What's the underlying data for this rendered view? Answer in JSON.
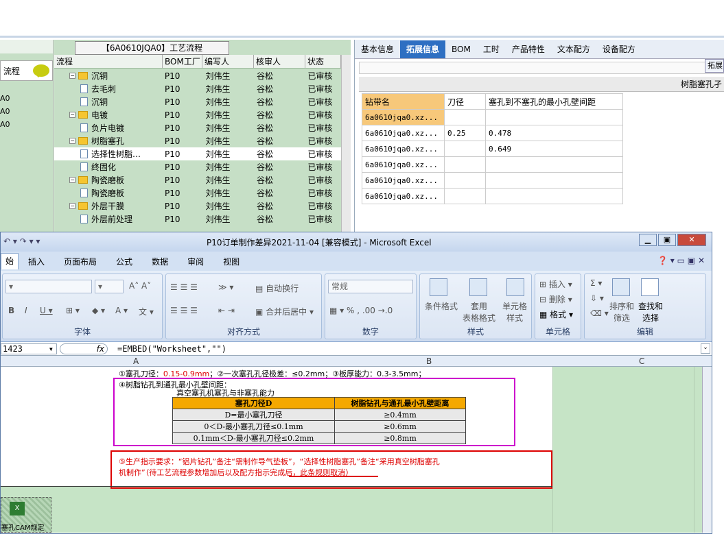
{
  "left_panel": {
    "button_label": "流程",
    "rows": [
      "A0",
      "A0",
      "A0"
    ]
  },
  "tree": {
    "window_title": "【6A0610JQA0】工艺流程",
    "columns": [
      "流程",
      "BOM工厂",
      "编写人",
      "核审人",
      "状态"
    ],
    "rows": [
      {
        "level": 1,
        "type": "folder",
        "name": "沉铜",
        "bom": "P10",
        "author": "刘伟生",
        "reviewer": "谷松",
        "status": "已审核"
      },
      {
        "level": 2,
        "type": "doc",
        "name": "去毛刺",
        "bom": "P10",
        "author": "刘伟生",
        "reviewer": "谷松",
        "status": "已审核"
      },
      {
        "level": 2,
        "type": "doc",
        "name": "沉铜",
        "bom": "P10",
        "author": "刘伟生",
        "reviewer": "谷松",
        "status": "已审核"
      },
      {
        "level": 1,
        "type": "folder",
        "name": "电镀",
        "bom": "P10",
        "author": "刘伟生",
        "reviewer": "谷松",
        "status": "已审核"
      },
      {
        "level": 2,
        "type": "doc",
        "name": "负片电镀",
        "bom": "P10",
        "author": "刘伟生",
        "reviewer": "谷松",
        "status": "已审核"
      },
      {
        "level": 1,
        "type": "folder",
        "name": "树脂塞孔",
        "bom": "P10",
        "author": "刘伟生",
        "reviewer": "谷松",
        "status": "已审核"
      },
      {
        "level": 2,
        "type": "doc",
        "name": "选择性树脂…",
        "bom": "P10",
        "author": "刘伟生",
        "reviewer": "谷松",
        "status": "已审核",
        "selected": true
      },
      {
        "level": 2,
        "type": "doc",
        "name": "终固化",
        "bom": "P10",
        "author": "刘伟生",
        "reviewer": "谷松",
        "status": "已审核"
      },
      {
        "level": 1,
        "type": "folder",
        "name": "陶瓷磨板",
        "bom": "P10",
        "author": "刘伟生",
        "reviewer": "谷松",
        "status": "已审核"
      },
      {
        "level": 2,
        "type": "doc",
        "name": "陶瓷磨板",
        "bom": "P10",
        "author": "刘伟生",
        "reviewer": "谷松",
        "status": "已审核"
      },
      {
        "level": 1,
        "type": "folder",
        "name": "外层干膜",
        "bom": "P10",
        "author": "刘伟生",
        "reviewer": "谷松",
        "status": "已审核"
      },
      {
        "level": 2,
        "type": "doc",
        "name": "外层前处理",
        "bom": "P10",
        "author": "刘伟生",
        "reviewer": "谷松",
        "status": "已审核"
      }
    ]
  },
  "right_panel": {
    "tabs": [
      "基本信息",
      "拓展信息",
      "BOM",
      "工时",
      "产品特性",
      "文本配方",
      "设备配方"
    ],
    "active_tab": "拓展信息",
    "expand_button": "拓展",
    "band_label": "树脂塞孔孑",
    "table_headers": [
      "钻带名",
      "刀径",
      "塞孔到不塞孔的最小孔壁间距"
    ],
    "table_rows": [
      [
        "6a0610jqa0.xz...",
        "",
        ""
      ],
      [
        "6a0610jqa0.xz...",
        "0.25",
        "0.478"
      ],
      [
        "6a0610jqa0.xz...",
        "",
        "0.649"
      ],
      [
        "6a0610jqa0.xz...",
        "",
        ""
      ],
      [
        "6a0610jqa0.xz...",
        "",
        ""
      ],
      [
        "6a0610jqa0.xz...",
        "",
        ""
      ]
    ]
  },
  "excel": {
    "title": "P10订单制作差异2021-11-04  [兼容模式] - Microsoft Excel",
    "ribbon_tabs": [
      "始",
      "插入",
      "页面布局",
      "公式",
      "数据",
      "审阅",
      "视图"
    ],
    "groups": {
      "font": "字体",
      "align": "对齐方式",
      "number": "数字",
      "style": "样式",
      "cells": "单元格",
      "edit": "编辑"
    },
    "buttons": {
      "wrap": "自动换行",
      "merge": "合并后居中",
      "number_format": "常规",
      "cond_format": "条件格式",
      "table_format": "套用\n表格格式",
      "cell_style": "单元格\n样式",
      "insert": "插入",
      "delete": "删除",
      "format": "格式",
      "sort": "排序和\n筛选",
      "find": "查找和\n选择"
    },
    "name_box": "1423",
    "formula": "=EMBED(\"Worksheet\",\"\")",
    "columns": [
      "A",
      "B",
      "C"
    ],
    "content": {
      "line1_a": "①塞孔刀径：",
      "line1_b": "0.15-0.9mm",
      "line1_c": "；②一次塞孔孔径极差：≤0.2mm；③板厚能力：0.3-3.5mm；",
      "line2": "④树脂钻孔到通孔最小孔壁间距：",
      "inner_title": "真空塞孔机塞孔与非塞孔能力",
      "inner_headers": [
        "塞孔刀径D",
        "树脂钻孔与通孔最小孔壁距离"
      ],
      "inner_rows": [
        [
          "D=最小塞孔刀径",
          "≥0.4mm"
        ],
        [
          "0＜D-最小塞孔刀径≤0.1mm",
          "≥0.6mm"
        ],
        [
          "0.1mm＜D-最小塞孔刀径≤0.2mm",
          "≥0.8mm"
        ]
      ],
      "note1": "⑤生产指示要求：“铝片钻孔”备注“需制作导气垫板”，“选择性树脂塞孔”备注“采用真空树脂塞孔",
      "note2": "机制作”（待工艺流程参数增加后以及配方指示完成后，此条规则取消）"
    },
    "embedded_label": "塞孔CAM规定"
  },
  "colors": {
    "tree_bg": "#c6dfc6",
    "active_tab": "#2e6fc2",
    "highlight": "#f7c87a",
    "red_note": "#dd0000",
    "magenta_box": "#cc00cc"
  }
}
